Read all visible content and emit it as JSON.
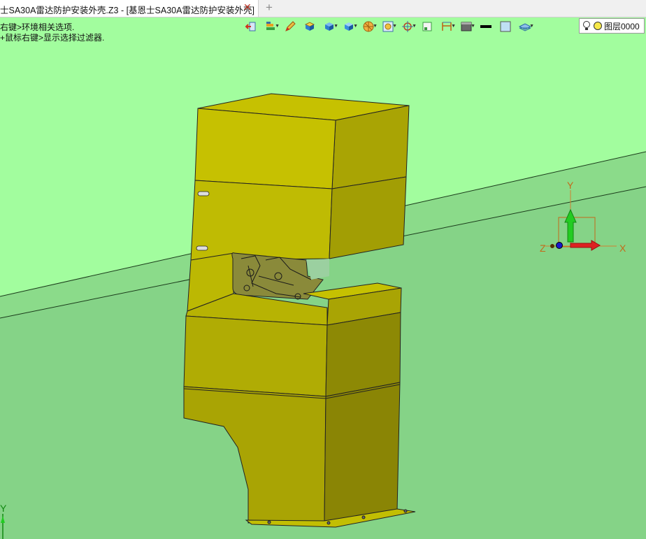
{
  "tab": {
    "title": "士SA30A雷达防护安装外壳.Z3 - [基恩士SA30A雷达防护安装外壳]",
    "close_glyph": "✕",
    "add_glyph": "+"
  },
  "hints": {
    "line1": "右键>环境相关选项.",
    "line2": "+鼠标右键>显示选择过滤器."
  },
  "toolbar": {
    "icons": [
      "exit-icon",
      "history-icon",
      "edit-icon",
      "box-view-icon",
      "shaded-icon",
      "render-mode-icon",
      "orientation-icon",
      "view-fit-icon",
      "target-icon",
      "section-icon",
      "dimension-icon",
      "display-icon",
      "line-color-icon",
      "fill-color-icon",
      "layer-view-icon"
    ]
  },
  "layer": {
    "label": "图层0000",
    "bulb_icon": "lightbulb-icon",
    "status_color": "#f7e94a"
  },
  "triad": {
    "x": "X",
    "y": "Y",
    "z": "Z"
  },
  "corner_axis": {
    "y": "Y"
  },
  "colors": {
    "background": "#a2fd9e",
    "plane": "#85d387",
    "model_light": "#c6c101",
    "model_mid": "#a9a404",
    "model_dark": "#8d8905"
  }
}
